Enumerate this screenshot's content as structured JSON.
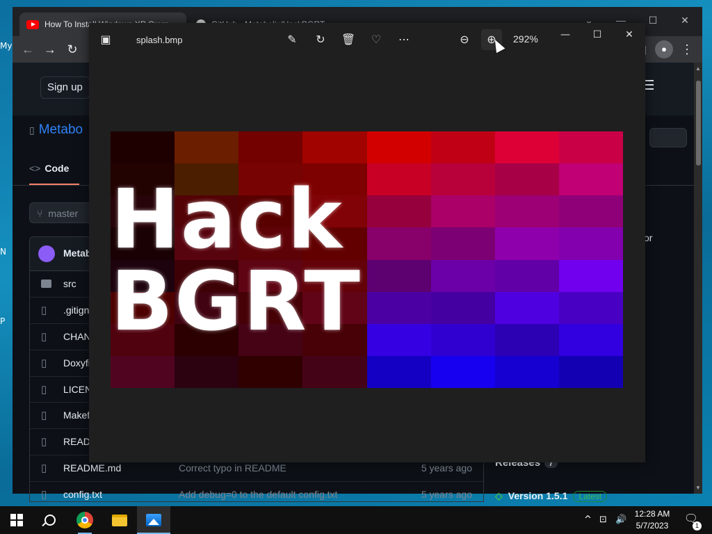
{
  "desktop": {
    "fragments": [
      "My",
      "N",
      "P"
    ]
  },
  "browser": {
    "tabs": [
      {
        "label": "How To Install Windows XP Crom...",
        "icon": "youtube-icon"
      },
      {
        "label": "GitHub - Metabolix/HackBGRT...",
        "icon": "github-icon"
      }
    ],
    "github": {
      "signup_label": "Sign up",
      "repo_name_fragment": "Metabo",
      "code_tab_label": "Code",
      "branch_label": "master",
      "owner_fragment": "Metab",
      "files": [
        {
          "name": "src",
          "type": "folder",
          "message": "",
          "age": ""
        },
        {
          "name": ".gitign",
          "type": "file",
          "message": "",
          "age": ""
        },
        {
          "name": "CHAN",
          "type": "file",
          "message": "",
          "age": ""
        },
        {
          "name": "Doxyfi",
          "type": "file",
          "message": "",
          "age": ""
        },
        {
          "name": "LICEN",
          "type": "file",
          "message": "",
          "age": ""
        },
        {
          "name": "Makef",
          "type": "file",
          "message": "",
          "age": ""
        },
        {
          "name": "READI",
          "type": "file",
          "message": "",
          "age": ""
        },
        {
          "name": "README.md",
          "type": "file",
          "message": "Correct typo in README",
          "age": "5 years ago"
        },
        {
          "name": "config.txt",
          "type": "file",
          "message": "Add debug=0 to the default config.txt",
          "age": "5 years ago"
        }
      ],
      "side_fragment": "or",
      "releases_label": "Releases",
      "releases_count": "7",
      "version_label": "Version 1.5.1",
      "latest_badge": "Latest"
    }
  },
  "photos": {
    "file_name": "splash.bmp",
    "zoom": "292%",
    "toolbar_icons": [
      "edit-icon",
      "rotate-icon",
      "delete-icon",
      "favorite-icon",
      "more-icon",
      "zoom-out-icon",
      "zoom-in-icon"
    ],
    "image_text": "Hack BGRT"
  },
  "taskbar": {
    "time": "12:28 AM",
    "date": "5/7/2023",
    "notification_count": "1"
  }
}
